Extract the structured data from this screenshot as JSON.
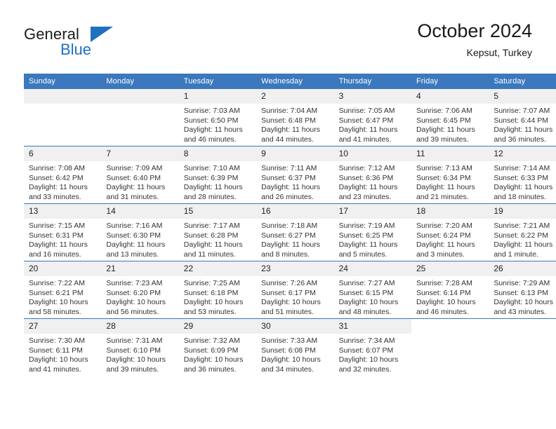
{
  "brand": {
    "word_general": "General",
    "word_blue": "Blue",
    "accent_color": "#1f70c1"
  },
  "header": {
    "title": "October 2024",
    "subtitle": "Kepsut, Turkey"
  },
  "calendar": {
    "header_bg": "#3b78bd",
    "daynum_bg": "#f0f0f0",
    "weekday_headers": [
      "Sunday",
      "Monday",
      "Tuesday",
      "Wednesday",
      "Thursday",
      "Friday",
      "Saturday"
    ],
    "weeks": [
      [
        {
          "day": "",
          "blank": true
        },
        {
          "day": "",
          "blank": true
        },
        {
          "day": "1",
          "sunrise": "Sunrise: 7:03 AM",
          "sunset": "Sunset: 6:50 PM",
          "daylight1": "Daylight: 11 hours",
          "daylight2": "and 46 minutes."
        },
        {
          "day": "2",
          "sunrise": "Sunrise: 7:04 AM",
          "sunset": "Sunset: 6:48 PM",
          "daylight1": "Daylight: 11 hours",
          "daylight2": "and 44 minutes."
        },
        {
          "day": "3",
          "sunrise": "Sunrise: 7:05 AM",
          "sunset": "Sunset: 6:47 PM",
          "daylight1": "Daylight: 11 hours",
          "daylight2": "and 41 minutes."
        },
        {
          "day": "4",
          "sunrise": "Sunrise: 7:06 AM",
          "sunset": "Sunset: 6:45 PM",
          "daylight1": "Daylight: 11 hours",
          "daylight2": "and 39 minutes."
        },
        {
          "day": "5",
          "sunrise": "Sunrise: 7:07 AM",
          "sunset": "Sunset: 6:44 PM",
          "daylight1": "Daylight: 11 hours",
          "daylight2": "and 36 minutes."
        }
      ],
      [
        {
          "day": "6",
          "sunrise": "Sunrise: 7:08 AM",
          "sunset": "Sunset: 6:42 PM",
          "daylight1": "Daylight: 11 hours",
          "daylight2": "and 33 minutes."
        },
        {
          "day": "7",
          "sunrise": "Sunrise: 7:09 AM",
          "sunset": "Sunset: 6:40 PM",
          "daylight1": "Daylight: 11 hours",
          "daylight2": "and 31 minutes."
        },
        {
          "day": "8",
          "sunrise": "Sunrise: 7:10 AM",
          "sunset": "Sunset: 6:39 PM",
          "daylight1": "Daylight: 11 hours",
          "daylight2": "and 28 minutes."
        },
        {
          "day": "9",
          "sunrise": "Sunrise: 7:11 AM",
          "sunset": "Sunset: 6:37 PM",
          "daylight1": "Daylight: 11 hours",
          "daylight2": "and 26 minutes."
        },
        {
          "day": "10",
          "sunrise": "Sunrise: 7:12 AM",
          "sunset": "Sunset: 6:36 PM",
          "daylight1": "Daylight: 11 hours",
          "daylight2": "and 23 minutes."
        },
        {
          "day": "11",
          "sunrise": "Sunrise: 7:13 AM",
          "sunset": "Sunset: 6:34 PM",
          "daylight1": "Daylight: 11 hours",
          "daylight2": "and 21 minutes."
        },
        {
          "day": "12",
          "sunrise": "Sunrise: 7:14 AM",
          "sunset": "Sunset: 6:33 PM",
          "daylight1": "Daylight: 11 hours",
          "daylight2": "and 18 minutes."
        }
      ],
      [
        {
          "day": "13",
          "sunrise": "Sunrise: 7:15 AM",
          "sunset": "Sunset: 6:31 PM",
          "daylight1": "Daylight: 11 hours",
          "daylight2": "and 16 minutes."
        },
        {
          "day": "14",
          "sunrise": "Sunrise: 7:16 AM",
          "sunset": "Sunset: 6:30 PM",
          "daylight1": "Daylight: 11 hours",
          "daylight2": "and 13 minutes."
        },
        {
          "day": "15",
          "sunrise": "Sunrise: 7:17 AM",
          "sunset": "Sunset: 6:28 PM",
          "daylight1": "Daylight: 11 hours",
          "daylight2": "and 11 minutes."
        },
        {
          "day": "16",
          "sunrise": "Sunrise: 7:18 AM",
          "sunset": "Sunset: 6:27 PM",
          "daylight1": "Daylight: 11 hours",
          "daylight2": "and 8 minutes."
        },
        {
          "day": "17",
          "sunrise": "Sunrise: 7:19 AM",
          "sunset": "Sunset: 6:25 PM",
          "daylight1": "Daylight: 11 hours",
          "daylight2": "and 5 minutes."
        },
        {
          "day": "18",
          "sunrise": "Sunrise: 7:20 AM",
          "sunset": "Sunset: 6:24 PM",
          "daylight1": "Daylight: 11 hours",
          "daylight2": "and 3 minutes."
        },
        {
          "day": "19",
          "sunrise": "Sunrise: 7:21 AM",
          "sunset": "Sunset: 6:22 PM",
          "daylight1": "Daylight: 11 hours",
          "daylight2": "and 1 minute."
        }
      ],
      [
        {
          "day": "20",
          "sunrise": "Sunrise: 7:22 AM",
          "sunset": "Sunset: 6:21 PM",
          "daylight1": "Daylight: 10 hours",
          "daylight2": "and 58 minutes."
        },
        {
          "day": "21",
          "sunrise": "Sunrise: 7:23 AM",
          "sunset": "Sunset: 6:20 PM",
          "daylight1": "Daylight: 10 hours",
          "daylight2": "and 56 minutes."
        },
        {
          "day": "22",
          "sunrise": "Sunrise: 7:25 AM",
          "sunset": "Sunset: 6:18 PM",
          "daylight1": "Daylight: 10 hours",
          "daylight2": "and 53 minutes."
        },
        {
          "day": "23",
          "sunrise": "Sunrise: 7:26 AM",
          "sunset": "Sunset: 6:17 PM",
          "daylight1": "Daylight: 10 hours",
          "daylight2": "and 51 minutes."
        },
        {
          "day": "24",
          "sunrise": "Sunrise: 7:27 AM",
          "sunset": "Sunset: 6:15 PM",
          "daylight1": "Daylight: 10 hours",
          "daylight2": "and 48 minutes."
        },
        {
          "day": "25",
          "sunrise": "Sunrise: 7:28 AM",
          "sunset": "Sunset: 6:14 PM",
          "daylight1": "Daylight: 10 hours",
          "daylight2": "and 46 minutes."
        },
        {
          "day": "26",
          "sunrise": "Sunrise: 7:29 AM",
          "sunset": "Sunset: 6:13 PM",
          "daylight1": "Daylight: 10 hours",
          "daylight2": "and 43 minutes."
        }
      ],
      [
        {
          "day": "27",
          "sunrise": "Sunrise: 7:30 AM",
          "sunset": "Sunset: 6:11 PM",
          "daylight1": "Daylight: 10 hours",
          "daylight2": "and 41 minutes."
        },
        {
          "day": "28",
          "sunrise": "Sunrise: 7:31 AM",
          "sunset": "Sunset: 6:10 PM",
          "daylight1": "Daylight: 10 hours",
          "daylight2": "and 39 minutes."
        },
        {
          "day": "29",
          "sunrise": "Sunrise: 7:32 AM",
          "sunset": "Sunset: 6:09 PM",
          "daylight1": "Daylight: 10 hours",
          "daylight2": "and 36 minutes."
        },
        {
          "day": "30",
          "sunrise": "Sunrise: 7:33 AM",
          "sunset": "Sunset: 6:08 PM",
          "daylight1": "Daylight: 10 hours",
          "daylight2": "and 34 minutes."
        },
        {
          "day": "31",
          "sunrise": "Sunrise: 7:34 AM",
          "sunset": "Sunset: 6:07 PM",
          "daylight1": "Daylight: 10 hours",
          "daylight2": "and 32 minutes."
        },
        {
          "day": "",
          "blank": true
        },
        {
          "day": "",
          "blank": true
        }
      ]
    ]
  }
}
